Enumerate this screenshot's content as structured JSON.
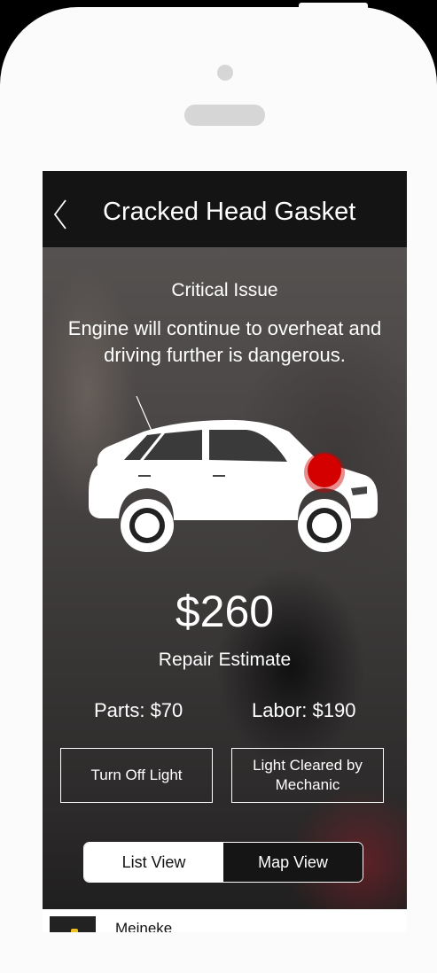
{
  "header": {
    "title": "Cracked Head Gasket"
  },
  "issue": {
    "severity": "Critical Issue",
    "description_line1": "Engine will continue to overheat and",
    "description_line2": "driving further is dangerous."
  },
  "estimate": {
    "price": "$260",
    "label": "Repair Estimate",
    "parts": "Parts: $70",
    "labor": "Labor: $190"
  },
  "actions": {
    "turn_off": "Turn Off Light",
    "cleared_line1": "Light Cleared by",
    "cleared_line2": "Mechanic"
  },
  "view_toggle": {
    "list": "List View",
    "map": "Map View",
    "selected": "List View"
  },
  "list": {
    "first_item": "Meineke"
  },
  "colors": {
    "problem_marker": "#d40000",
    "topbar": "#141414"
  }
}
